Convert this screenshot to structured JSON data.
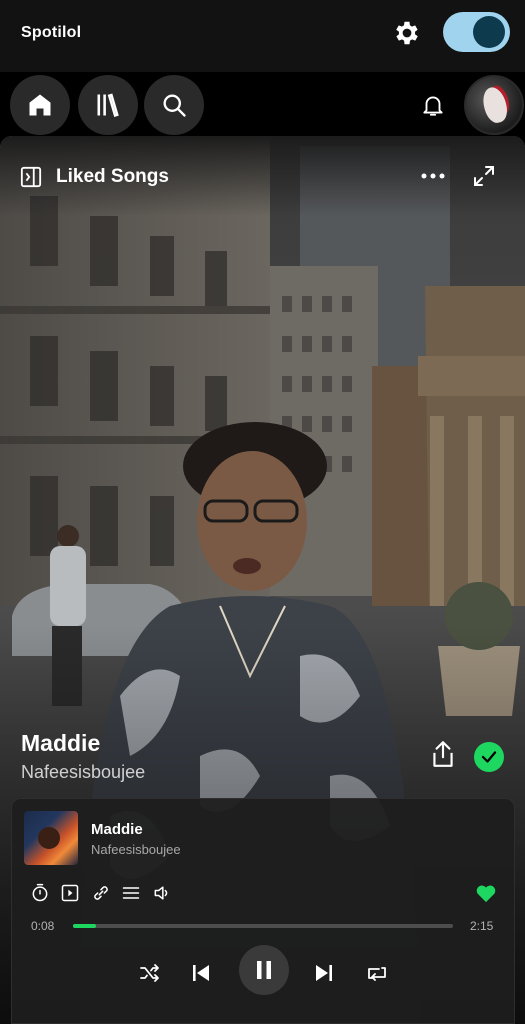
{
  "app": {
    "title": "Spotilol",
    "toggle_on": true
  },
  "nav": {
    "items": [
      "home-icon",
      "library-icon",
      "search-icon"
    ],
    "notifications_icon": "bell-icon"
  },
  "now_playing": {
    "header": "Liked Songs",
    "track_title": "Maddie",
    "artist": "Nafeesisboujee",
    "liked": true
  },
  "player": {
    "title": "Maddie",
    "artist": "Nafeesisboujee",
    "current_time": "0:08",
    "total_time": "2:15",
    "progress": 0.06,
    "tools": [
      "timer-icon",
      "video-icon",
      "link-icon",
      "queue-icon",
      "volume-icon"
    ],
    "controls": [
      "shuffle-icon",
      "previous-icon",
      "pause-icon",
      "next-icon",
      "repeat-icon"
    ]
  },
  "colors": {
    "accent": "#1ed760",
    "toggle": "#9fd3ee",
    "background": "#121212"
  }
}
